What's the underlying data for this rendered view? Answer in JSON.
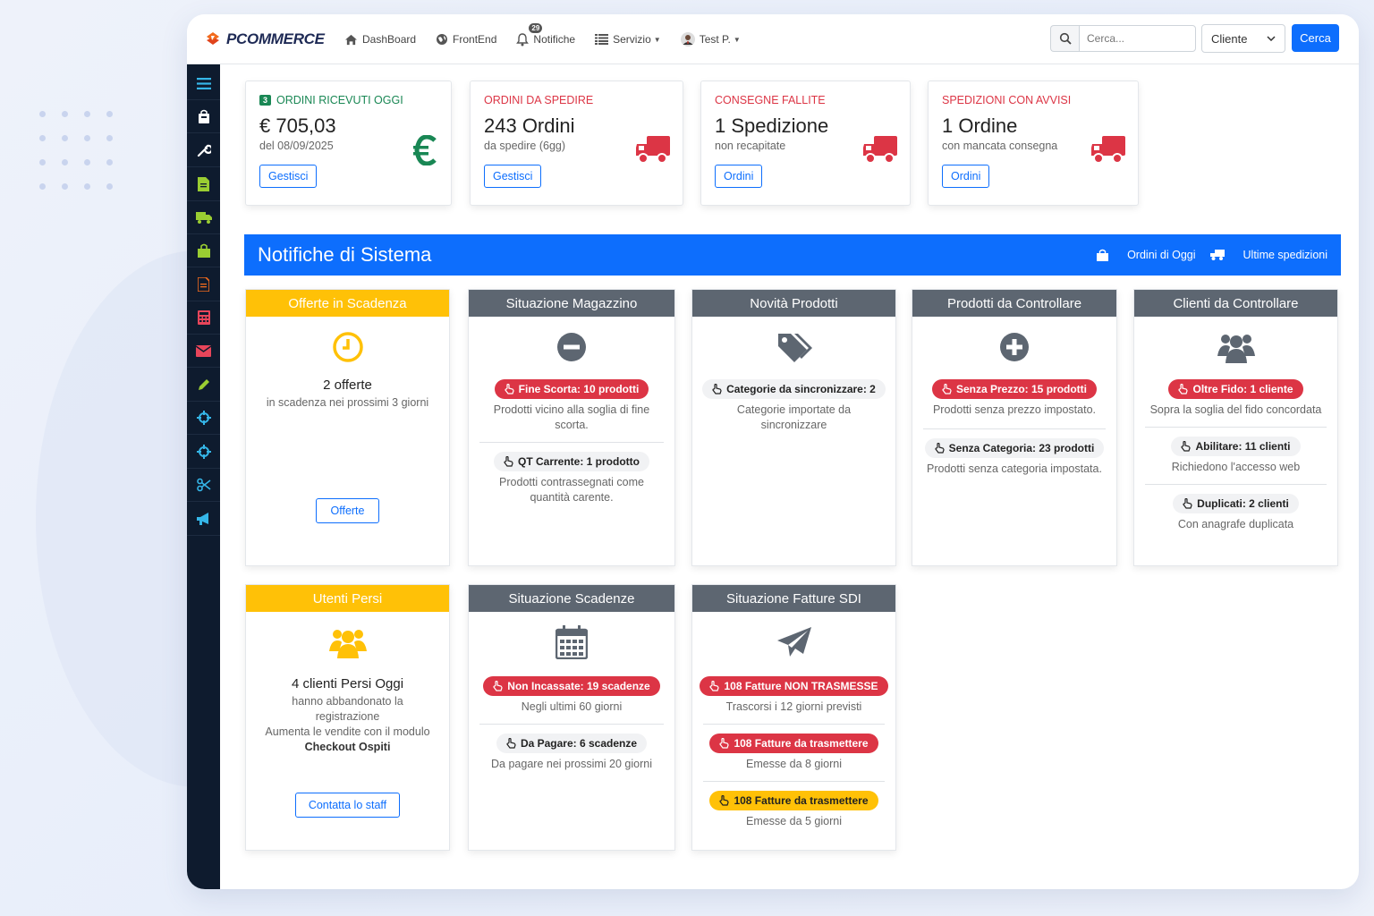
{
  "brand": {
    "name": "PCOMMERCE"
  },
  "nav": {
    "dashboard": "DashBoard",
    "frontend": "FrontEnd",
    "notifiche": "Notifiche",
    "notifiche_badge": "29",
    "servizio": "Servizio",
    "user": "Test P."
  },
  "search": {
    "placeholder": "Cerca...",
    "select_value": "Cliente",
    "button": "Cerca"
  },
  "stats": [
    {
      "badge": "3",
      "label": "ORDINI RICEVUTI OGGI",
      "value": "€ 705,03",
      "sub": "del 08/09/2025",
      "button": "Gestisci"
    },
    {
      "label": "ORDINI DA SPEDIRE",
      "value": "243 Ordini",
      "sub": "da spedire (6gg)",
      "button": "Gestisci"
    },
    {
      "label": "CONSEGNE FALLITE",
      "value": "1 Spedizione",
      "sub": "non recapitate",
      "button": "Ordini"
    },
    {
      "label": "SPEDIZIONI CON AVVISI",
      "value": "1 Ordine",
      "sub": "con mancata consegna",
      "button": "Ordini"
    }
  ],
  "section": {
    "title": "Notifiche di Sistema",
    "link1": "Ordini di Oggi",
    "link2": "Ultime spedizioni"
  },
  "panels": {
    "offerte": {
      "title": "Offerte in Scadenza",
      "big": "2 offerte",
      "text": "in scadenza nei prossimi 3 giorni",
      "button": "Offerte"
    },
    "magazzino": {
      "title": "Situazione Magazzino",
      "pill1": "Fine Scorta: 10 prodotti",
      "text1": "Prodotti vicino alla soglia di fine scorta.",
      "pill2": "QT Carrente: 1 prodotto",
      "text2": "Prodotti contrassegnati come quantità carente."
    },
    "novita": {
      "title": "Novità Prodotti",
      "pill1": "Categorie da sincronizzare: 2",
      "text1": "Categorie importate da sincronizzare"
    },
    "controllare": {
      "title": "Prodotti da Controllare",
      "pill1": "Senza Prezzo: 15 prodotti",
      "text1": "Prodotti senza prezzo impostato.",
      "pill2": "Senza Categoria: 23 prodotti",
      "text2": "Prodotti senza categoria impostata."
    },
    "clienti": {
      "title": "Clienti da Controllare",
      "pill1": "Oltre Fido: 1 cliente",
      "text1": "Sopra la soglia del fido concordata",
      "pill2": "Abilitare: 11 clienti",
      "text2": "Richiedono l'accesso web",
      "pill3": "Duplicati: 2 clienti",
      "text3": "Con anagrafe duplicata"
    },
    "utenti": {
      "title": "Utenti Persi",
      "big": "4 clienti Persi Oggi",
      "text1": "hanno abbandonato la registrazione",
      "text2": "Aumenta le vendite con il modulo",
      "text3": "Checkout Ospiti",
      "button": "Contatta lo staff"
    },
    "scadenze": {
      "title": "Situazione Scadenze",
      "pill1": "Non Incassate: 19 scadenze",
      "text1": "Negli ultimi 60 giorni",
      "pill2": "Da Pagare: 6 scadenze",
      "text2": "Da pagare nei prossimi 20 giorni"
    },
    "fatture": {
      "title": "Situazione Fatture SDI",
      "pill1": "108 Fatture NON TRASMESSE",
      "text1": "Trascorsi i 12 giorni previsti",
      "pill2": "108 Fatture da trasmettere",
      "text2": "Emesse da 8 giorni",
      "pill3": "108 Fatture da trasmettere",
      "text3": "Emesse da 5 giorni"
    }
  }
}
